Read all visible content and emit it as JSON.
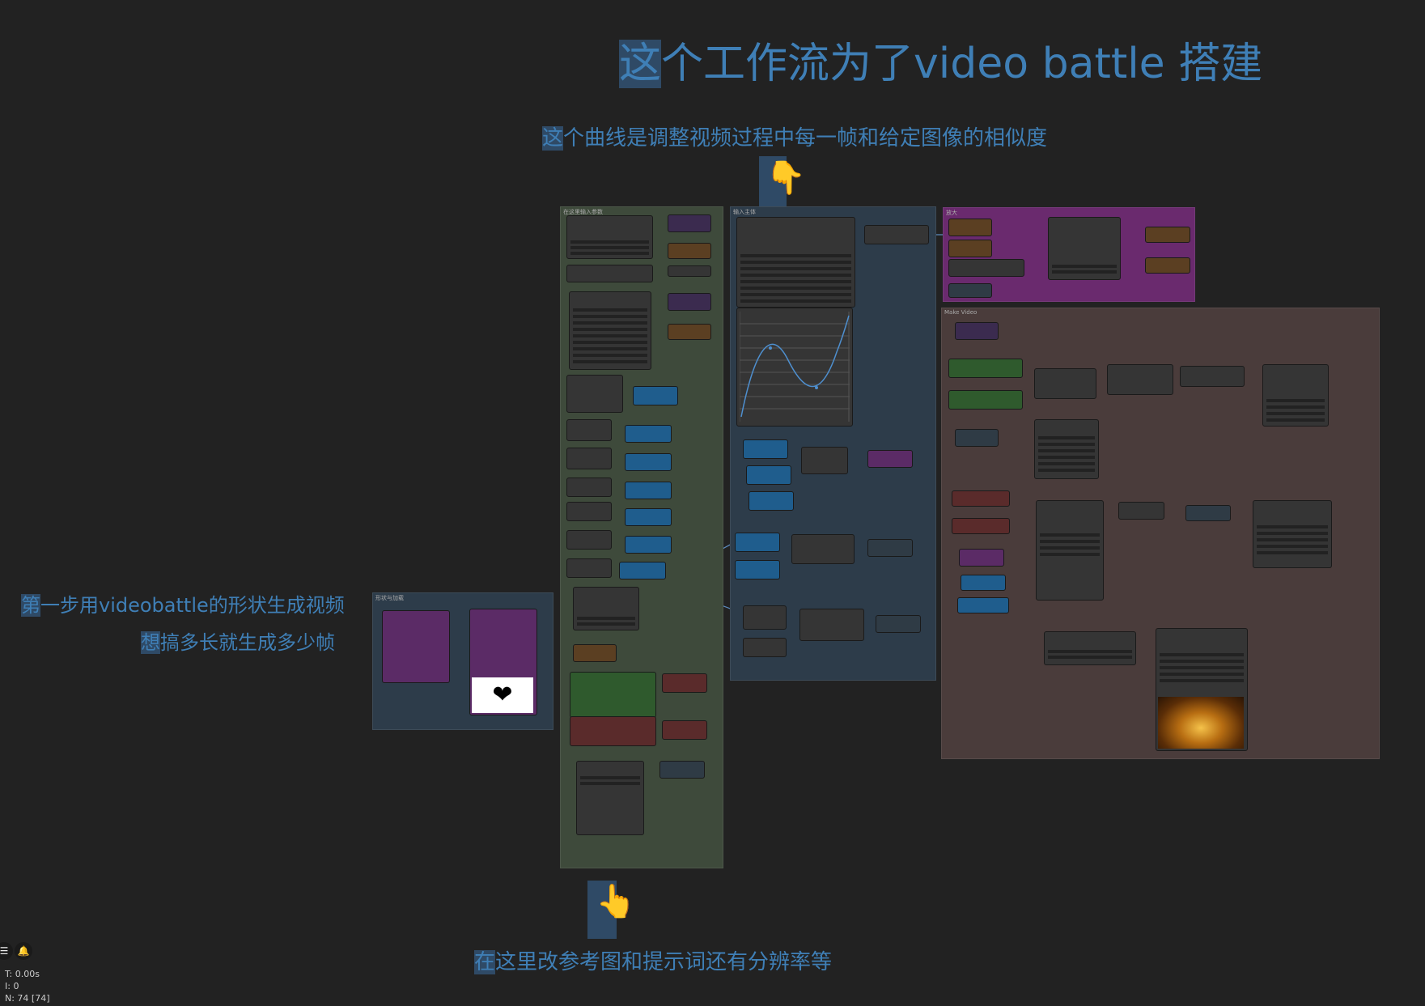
{
  "notes": {
    "title_hl": "这",
    "title_rest": "个工作流为了video battle 搭建",
    "curve_hl": "这",
    "curve_rest": "个曲线是调整视频过程中每一帧和给定图像的相似度",
    "step1_hl": "第",
    "step1_rest": "一步用videobattle的形状生成视频",
    "step2_hl": "想",
    "step2_rest": "搞多长就生成多少帧",
    "bottom_hl": "在",
    "bottom_rest": "这里改参考图和提示词还有分辨率等"
  },
  "groups": {
    "input_params": "在这里输入参数",
    "main": "输入主体",
    "upscale": "放大",
    "video": "Make Video",
    "shape": "形状与加载"
  },
  "icons": {
    "pointer_down": "👇",
    "pointer_up": "👆",
    "heart": "❤"
  },
  "stats": {
    "time": "T: 0.00s",
    "iter": "I: 0",
    "nodes": "N: 74 [74]"
  },
  "colors": {
    "background": "#222222",
    "note_text": "#3f7fb6",
    "note_highlight": "#2f4a66",
    "group_green": "#3e4a3b",
    "group_blue": "#2d3c4a",
    "group_purple": "#6a2a6e",
    "group_brown": "#4a3c3b"
  }
}
